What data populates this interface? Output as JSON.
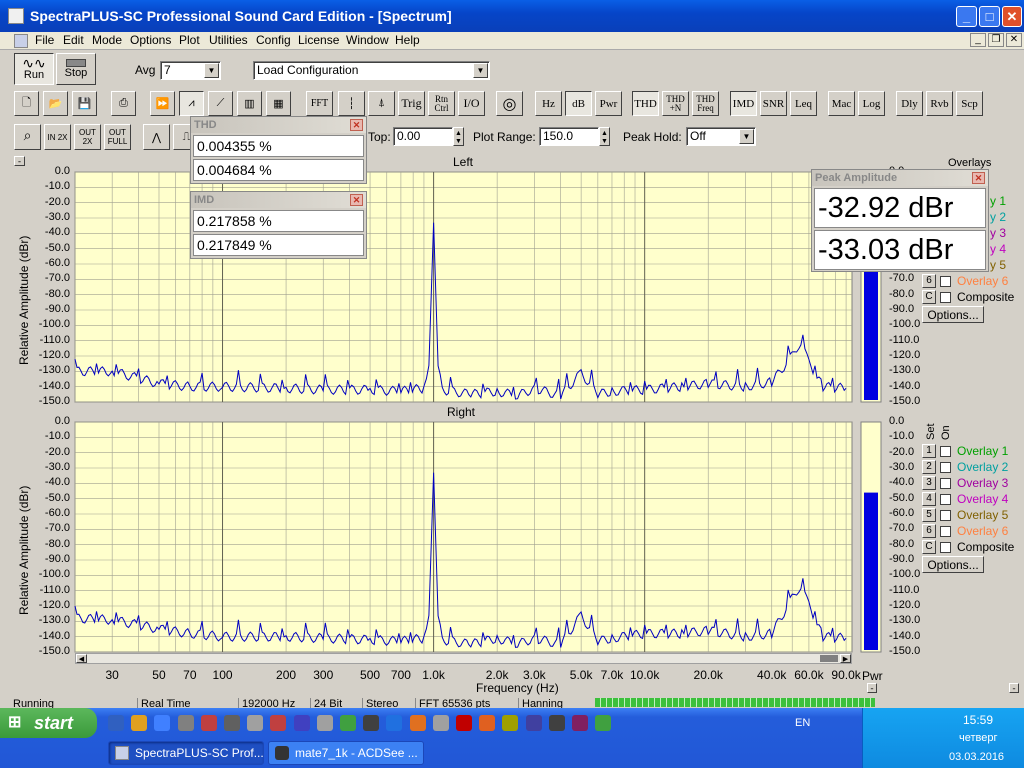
{
  "window": {
    "title": "SpectraPLUS-SC Professional Sound Card Edition - [Spectrum]"
  },
  "menu": [
    "File",
    "Edit",
    "Mode",
    "Options",
    "Plot",
    "Utilities",
    "Config",
    "License",
    "Window",
    "Help"
  ],
  "toolbar1": {
    "run": "Run",
    "stop": "Stop",
    "avg_label": "Avg",
    "avg_value": "7",
    "config_value": "Load Configuration"
  },
  "toolbar2": [
    "FFT",
    "Trig",
    "Rtn Ctrl",
    "I/O",
    "Hz",
    "dB",
    "Pwr",
    "THD",
    "THD +N",
    "THD Freq",
    "IMD",
    "SNR",
    "Leq",
    "Mac",
    "Log",
    "Dly",
    "Rvb",
    "Scp"
  ],
  "toolbar3": {
    "zoom_in": "IN 2X",
    "zoom_out": "OUT 2X",
    "full": "OUT FULL",
    "top_label": "Top:",
    "top_value": "0.00",
    "range_label": "Plot Range:",
    "range_value": "150.0",
    "peak_label": "Peak Hold:",
    "peak_value": "Off"
  },
  "thd": {
    "title": "THD",
    "v1": "0.004355 %",
    "v2": "0.004684 %"
  },
  "imd": {
    "title": "IMD",
    "v1": "0.217858 %",
    "v2": "0.217849 %"
  },
  "peak": {
    "title": "Peak Amplitude",
    "v1": "-32.92 dBr",
    "v2": "-33.03 dBr"
  },
  "plots": {
    "left_title": "Left",
    "right_title": "Right",
    "ylabel": "Relative Amplitude (dBr)",
    "xlabel": "Frequency (Hz)",
    "yticks": [
      "0.0",
      "-10.0",
      "-20.0",
      "-30.0",
      "-40.0",
      "-50.0",
      "-60.0",
      "-70.0",
      "-80.0",
      "-90.0",
      "-100.0",
      "-110.0",
      "-120.0",
      "-130.0",
      "-140.0",
      "-150.0"
    ],
    "xticks": [
      "30",
      "50",
      "70",
      "100",
      "200",
      "300",
      "500",
      "700",
      "1.0k",
      "2.0k",
      "3.0k",
      "5.0k",
      "7.0k",
      "10.0k",
      "20.0k",
      "40.0k",
      "60.0k",
      "90.0k"
    ],
    "pwr": "Pwr",
    "set_label": "Set",
    "on_label": "On",
    "overlays_label": "Overlays",
    "options_btn": "Options...",
    "left_bar_level_db": -33,
    "right_bar_level_db": -33
  },
  "overlays": [
    {
      "num": "1",
      "label": "Overlay 1",
      "color": "#00a000"
    },
    {
      "num": "2",
      "label": "Overlay 2",
      "color": "#00a0a0"
    },
    {
      "num": "3",
      "label": "Overlay 3",
      "color": "#a000a0"
    },
    {
      "num": "4",
      "label": "Overlay 4",
      "color": "#c000c0"
    },
    {
      "num": "5",
      "label": "Overlay 5",
      "color": "#806000"
    },
    {
      "num": "6",
      "label": "Overlay 6",
      "color": "#ff8040"
    },
    {
      "num": "C",
      "label": "Composite",
      "color": "#000000"
    }
  ],
  "overlays_top_visible": [
    {
      "label": "y 1",
      "color": "#00a000"
    },
    {
      "label": "y 2",
      "color": "#00a0a0"
    },
    {
      "label": "y 3",
      "color": "#a000a0"
    },
    {
      "label": "y 4",
      "color": "#c000c0"
    },
    {
      "label": "y 5",
      "color": "#806000"
    }
  ],
  "status": [
    "Running",
    "Real Time",
    "192000 Hz",
    "24 Bit",
    "Stereo",
    "FFT 65536 pts",
    "Hanning"
  ],
  "taskbar": {
    "start": "start",
    "tasks": [
      "SpectraPLUS-SC Prof...",
      "mate7_1k - ACDSee ..."
    ],
    "lang": "EN",
    "time": "15:59",
    "day": "четверг",
    "date": "03.03.2016"
  },
  "chart_data": {
    "type": "line",
    "xlabel": "Frequency (Hz)",
    "ylabel": "Relative Amplitude (dBr)",
    "xscale": "log",
    "xlim": [
      20,
      96000
    ],
    "ylim": [
      -150,
      0
    ],
    "series": [
      {
        "name": "Left",
        "points": [
          [
            20,
            -130
          ],
          [
            30,
            -130
          ],
          [
            50,
            -138
          ],
          [
            70,
            -140
          ],
          [
            100,
            -140
          ],
          [
            200,
            -141
          ],
          [
            300,
            -142
          ],
          [
            500,
            -142
          ],
          [
            700,
            -143
          ],
          [
            900,
            -141
          ],
          [
            950,
            -125
          ],
          [
            1000,
            -33
          ],
          [
            1050,
            -125
          ],
          [
            1100,
            -142
          ],
          [
            1500,
            -145
          ],
          [
            2000,
            -143
          ],
          [
            2500,
            -146
          ],
          [
            3000,
            -141
          ],
          [
            4000,
            -146
          ],
          [
            5000,
            -131
          ],
          [
            6000,
            -145
          ],
          [
            7000,
            -143
          ],
          [
            10000,
            -142
          ],
          [
            15000,
            -140
          ],
          [
            20000,
            -138
          ],
          [
            30000,
            -140
          ],
          [
            40000,
            -137
          ],
          [
            50000,
            -120
          ],
          [
            55000,
            -110
          ],
          [
            60000,
            -125
          ],
          [
            70000,
            -140
          ],
          [
            90000,
            -141
          ]
        ]
      },
      {
        "name": "Right",
        "points": [
          [
            20,
            -128
          ],
          [
            30,
            -129
          ],
          [
            50,
            -135
          ],
          [
            70,
            -138
          ],
          [
            100,
            -140
          ],
          [
            200,
            -140
          ],
          [
            300,
            -141
          ],
          [
            500,
            -142
          ],
          [
            700,
            -143
          ],
          [
            900,
            -141
          ],
          [
            950,
            -125
          ],
          [
            1000,
            -33
          ],
          [
            1050,
            -125
          ],
          [
            1100,
            -142
          ],
          [
            1500,
            -145
          ],
          [
            2000,
            -141
          ],
          [
            2500,
            -145
          ],
          [
            3000,
            -141
          ],
          [
            4000,
            -145
          ],
          [
            5000,
            -126
          ],
          [
            6000,
            -143
          ],
          [
            7000,
            -141
          ],
          [
            10000,
            -138
          ],
          [
            15000,
            -138
          ],
          [
            20000,
            -136
          ],
          [
            30000,
            -140
          ],
          [
            40000,
            -138
          ],
          [
            50000,
            -115
          ],
          [
            55000,
            -106
          ],
          [
            60000,
            -120
          ],
          [
            70000,
            -140
          ],
          [
            90000,
            -141
          ]
        ]
      }
    ]
  }
}
